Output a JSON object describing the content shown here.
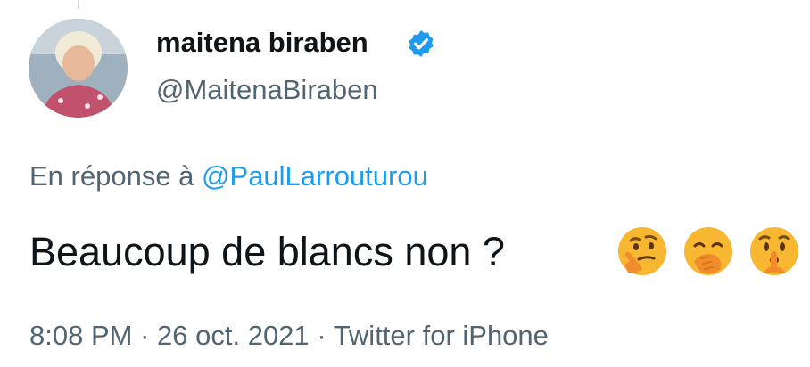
{
  "author": {
    "display_name": "maitena biraben",
    "handle": "@MaitenaBiraben",
    "verified": true,
    "avatar_icon": "profile-photo"
  },
  "reply": {
    "prefix": "En réponse à",
    "mention": "@PaulLarrouturou"
  },
  "tweet": {
    "text": "Beaucoup de blancs non ?",
    "emojis": [
      "thinking-face",
      "face-with-hand-over-mouth",
      "shushing-face"
    ]
  },
  "meta": {
    "time": "8:08 PM",
    "date": "26 oct. 2021",
    "source": "Twitter for iPhone",
    "separator": "·"
  },
  "colors": {
    "primary_text": "#0f1419",
    "secondary_text": "#536471",
    "link": "#1d9bf0",
    "verified_badge": "#1d9bf0",
    "emoji_yellow": "#f7b731"
  }
}
